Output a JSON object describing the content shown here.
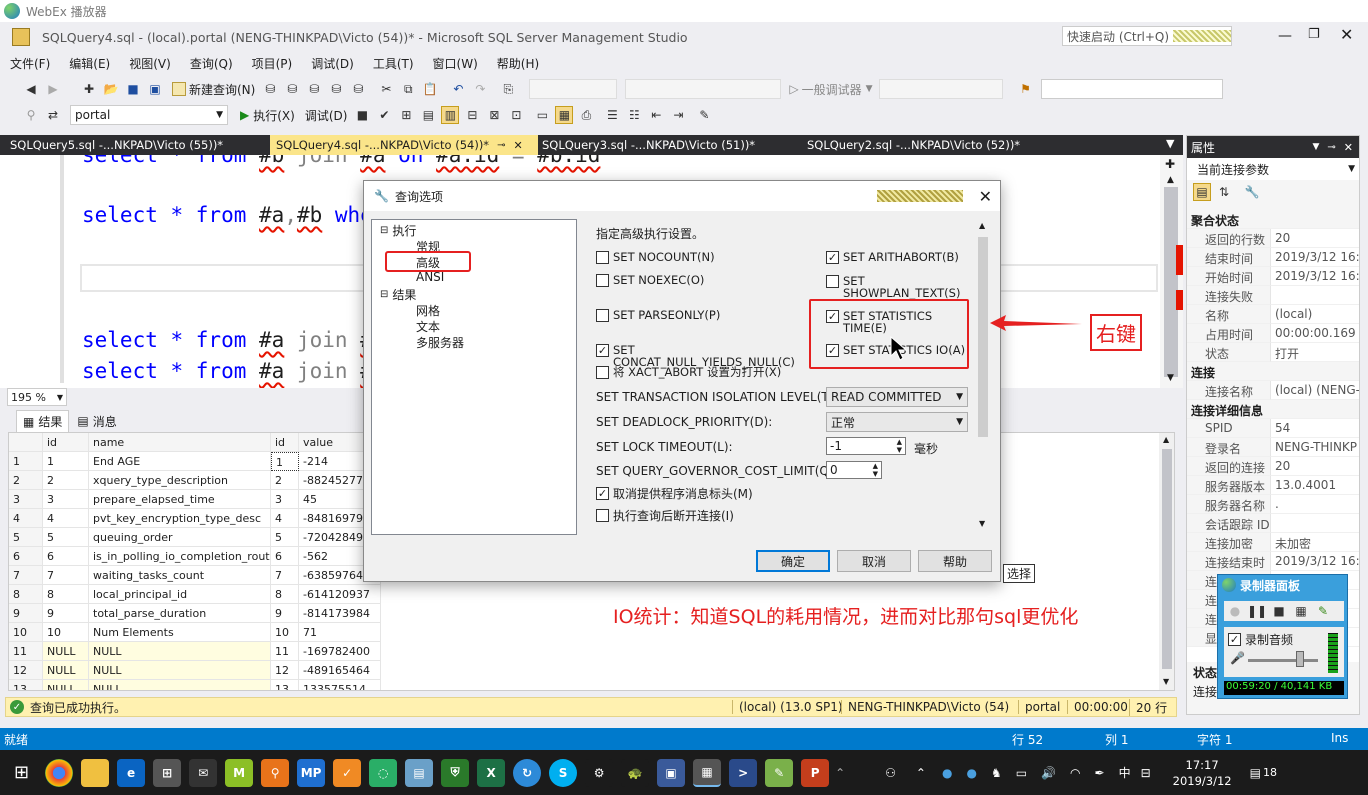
{
  "player": {
    "title": "WebEx 播放器"
  },
  "ssms": {
    "title": "SQLQuery4.sql - (local).portal (NENG-THINKPAD\\Victo (54))* - Microsoft SQL Server Management Studio",
    "quick_launch_placeholder": "快速启动 (Ctrl+Q)",
    "menu": [
      "文件(F)",
      "编辑(E)",
      "视图(V)",
      "查询(Q)",
      "项目(P)",
      "调试(D)",
      "工具(T)",
      "窗口(W)",
      "帮助(H)"
    ],
    "toolbar1": {
      "new_query": "新建查询(N)",
      "debugger": "一般调试器"
    },
    "toolbar2": {
      "database": "portal",
      "execute": "执行(X)",
      "debug": "调试(D)"
    },
    "doc_tabs": [
      "SQLQuery5.sql -...NKPAD\\Victo (55))*",
      "SQLQuery4.sql -...NKPAD\\Victo (54))*",
      "SQLQuery3.sql -...NKPAD\\Victo (51))*",
      "SQLQuery2.sql -...NKPAD\\Victo (52))*"
    ],
    "zoom": "195 %",
    "results_tabs": {
      "results": "结果",
      "messages": "消息"
    },
    "status_message": "查询已成功执行。",
    "status_server": "(local) (13.0 SP1)",
    "status_user": "NENG-THINKPAD\\Victo (54)",
    "status_db": "portal",
    "status_time": "00:00:00",
    "status_rows": "20 行",
    "bottom_status": {
      "ready": "就绪",
      "row": "行 52",
      "col": "列 1",
      "char": "字符 1",
      "ins": "Ins"
    },
    "select_label": "选择"
  },
  "code_lines": [
    {
      "a": "select * from ",
      "b": "#b",
      "c": " join ",
      "d": "#a",
      "e": " on ",
      "f": "#a.id",
      "g": " = ",
      "h": "#b.id"
    },
    {
      "a": "select * from ",
      "b": "#a",
      "c": ",",
      "d": "#b",
      "e": " whe"
    },
    {
      "a": "select * from ",
      "b": "#a",
      "c": " join ",
      "d": "#"
    },
    {
      "a": "select * from ",
      "b": "#a",
      "c": " join ",
      "d": "#"
    }
  ],
  "grid": {
    "headers": [
      "",
      "id",
      "name",
      "id",
      "value"
    ],
    "rows": [
      [
        "1",
        "1",
        "End AGE",
        "1",
        "-214"
      ],
      [
        "2",
        "2",
        "xquery_type_description",
        "2",
        "-882452774"
      ],
      [
        "3",
        "3",
        "prepare_elapsed_time",
        "3",
        "45"
      ],
      [
        "4",
        "4",
        "pvt_key_encryption_type_desc",
        "4",
        "-848169795"
      ],
      [
        "5",
        "5",
        "queuing_order",
        "5",
        "-720428490"
      ],
      [
        "6",
        "6",
        "is_in_polling_io_completion_routine",
        "6",
        "-562"
      ],
      [
        "7",
        "7",
        "waiting_tasks_count",
        "7",
        "-638597644"
      ],
      [
        "8",
        "8",
        "local_principal_id",
        "8",
        "-614120937"
      ],
      [
        "9",
        "9",
        "total_parse_duration",
        "9",
        "-814173984"
      ],
      [
        "10",
        "10",
        "Num Elements",
        "10",
        "71"
      ],
      [
        "11",
        "NULL",
        "NULL",
        "11",
        "-169782400"
      ],
      [
        "12",
        "NULL",
        "NULL",
        "12",
        "-489165464"
      ],
      [
        "13",
        "NULL",
        "NULL",
        "13",
        "133575514"
      ]
    ]
  },
  "properties": {
    "title": "属性",
    "object": "当前连接参数",
    "sections": [
      {
        "name": "聚合状态",
        "rows": [
          [
            "返回的行数",
            "20"
          ],
          [
            "结束时间",
            "2019/3/12 16:"
          ],
          [
            "开始时间",
            "2019/3/12 16:"
          ],
          [
            "连接失败",
            ""
          ],
          [
            "名称",
            "(local)"
          ],
          [
            "占用时间",
            "00:00:00.169"
          ],
          [
            "状态",
            "打开"
          ]
        ]
      },
      {
        "name": "连接",
        "rows": [
          [
            "连接名称",
            "(local) (NENG-"
          ]
        ]
      },
      {
        "name": "连接详细信息",
        "rows": [
          [
            "SPID",
            "54"
          ],
          [
            "登录名",
            "NENG-THINKP"
          ],
          [
            "返回的连接",
            "20"
          ],
          [
            "服务器版本",
            "13.0.4001"
          ],
          [
            "服务器名称",
            "."
          ],
          [
            "会话跟踪 ID",
            ""
          ],
          [
            "连接加密",
            "未加密"
          ],
          [
            "连接结束时",
            "2019/3/12 16:"
          ],
          [
            "连",
            ""
          ],
          [
            "连",
            ""
          ],
          [
            "连",
            ""
          ],
          [
            "显",
            ""
          ]
        ]
      }
    ],
    "footer": [
      "状态",
      "连接"
    ]
  },
  "dialog": {
    "title": "查询选项",
    "tree": {
      "execution": "执行",
      "exec_children": [
        "常规",
        "高级",
        "ANSI"
      ],
      "results": "结果",
      "results_children": [
        "网格",
        "文本",
        "多服务器"
      ]
    },
    "heading": "指定高级执行设置。",
    "checks_left": [
      {
        "label": "SET NOCOUNT(N)",
        "checked": false
      },
      {
        "label": "SET NOEXEC(O)",
        "checked": false
      },
      {
        "label": "SET PARSEONLY(P)",
        "checked": false
      },
      {
        "label": "SET CONCAT_NULL_YIELDS_NULL(C)",
        "checked": true
      },
      {
        "label": "将 XACT_ABORT 设置为打开(X)",
        "checked": false
      }
    ],
    "checks_right": [
      {
        "label": "SET ARITHABORT(B)",
        "checked": true
      },
      {
        "label": "SET SHOWPLAN_TEXT(S)",
        "checked": false
      },
      {
        "label": "SET STATISTICS TIME(E)",
        "checked": true
      },
      {
        "label": "SET STATISTICS IO(A)",
        "checked": true
      }
    ],
    "isolation_label": "SET TRANSACTION ISOLATION LEVEL(T):",
    "isolation_value": "READ COMMITTED",
    "deadlock_label": "SET DEADLOCK_PRIORITY(D):",
    "deadlock_value": "正常",
    "lock_label": "SET LOCK TIMEOUT(L):",
    "lock_value": "-1",
    "lock_unit": "毫秒",
    "governor_label": "SET QUERY_GOVERNOR_COST_LIMIT(Q):",
    "governor_value": "0",
    "suppress_label": "取消提供程序消息标头(M)",
    "suppress_checked": true,
    "disconnect_label": "执行查询后断开连接(I)",
    "disconnect_checked": false,
    "ok": "确定",
    "cancel": "取消",
    "help": "帮助"
  },
  "annotations": {
    "right_click": "右键",
    "io_note": "IO统计：知道SQL的耗用情况，进而对比那句sql更优化"
  },
  "recorder": {
    "title": "录制器面板",
    "audio": "录制音频",
    "timer": "00:59:20 / 40,141 KB"
  },
  "taskbar": {
    "time": "17:17",
    "date": "2019/3/12",
    "ime": "中",
    "notify": "18"
  }
}
